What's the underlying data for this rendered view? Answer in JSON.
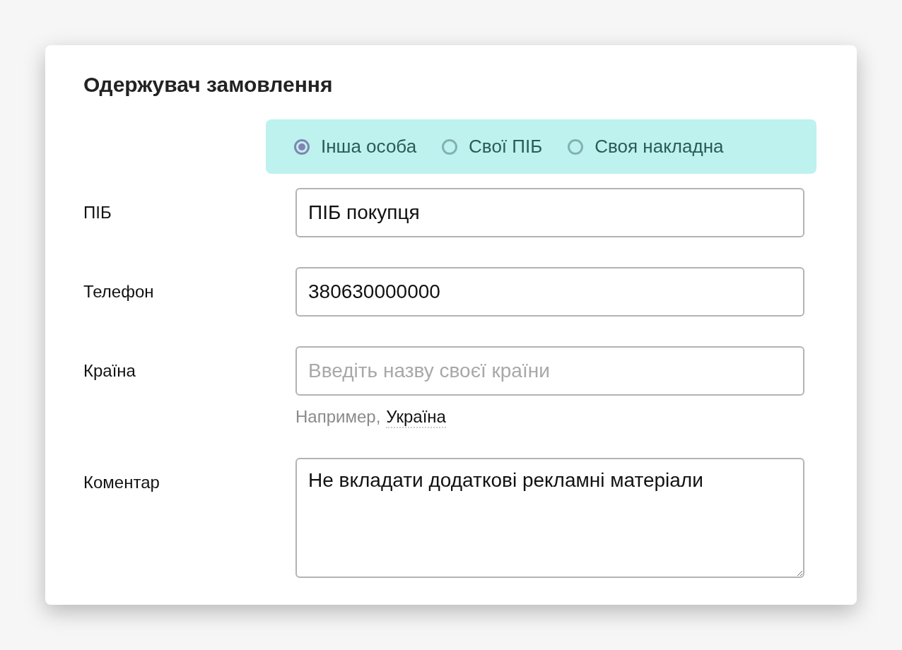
{
  "title": "Одержувач замовлення",
  "recipient_options": [
    {
      "label": "Інша особа",
      "selected": true
    },
    {
      "label": "Свої ПІБ",
      "selected": false
    },
    {
      "label": "Своя накладна",
      "selected": false
    }
  ],
  "fields": [
    {
      "kind": "input",
      "label": "ПІБ",
      "value": "ПІБ покупця"
    },
    {
      "kind": "input",
      "label": "Телефон",
      "value": "380630000000"
    },
    {
      "kind": "input",
      "label": "Країна",
      "placeholder": "Введіть назву своєї країни",
      "hint": "Например,",
      "hint_link": "Україна"
    },
    {
      "kind": "textarea",
      "label": "Коментар",
      "value": "Не вкладати додаткові рекламні матеріали"
    }
  ]
}
